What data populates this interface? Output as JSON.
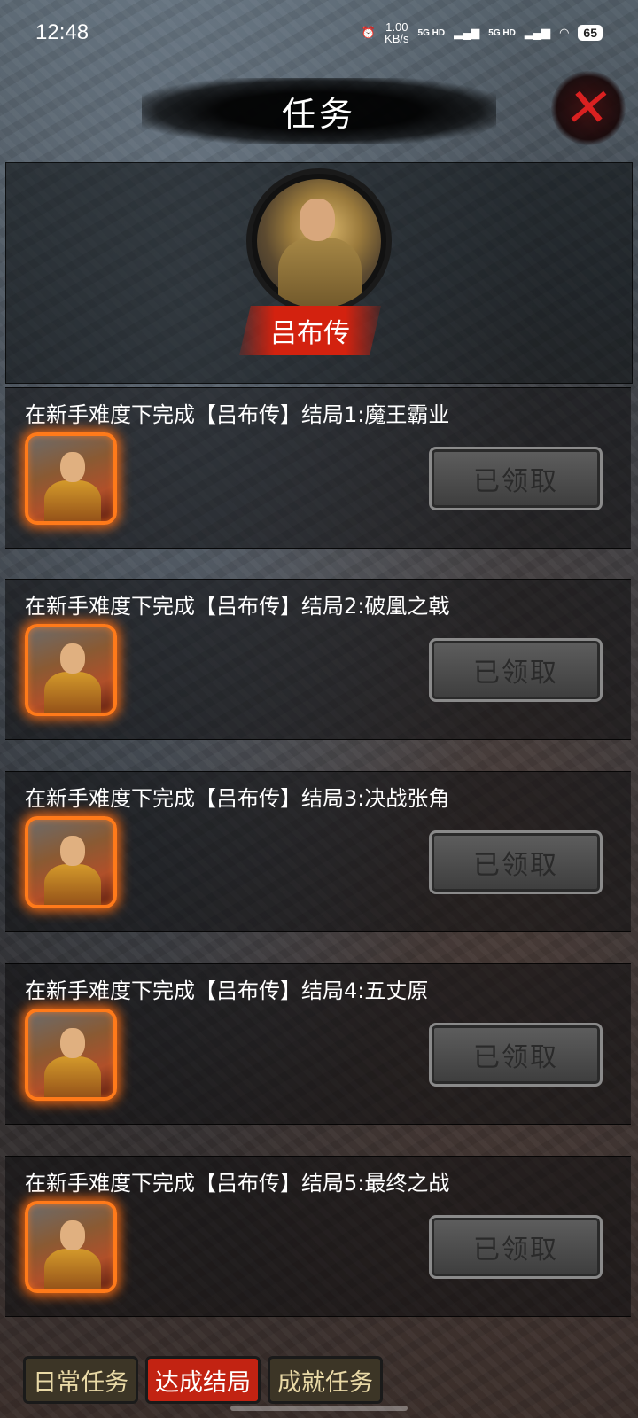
{
  "status_bar": {
    "time": "12:48",
    "rate_value": "1.00",
    "rate_unit": "KB/s",
    "net1": "5G HD",
    "net2": "5G HD",
    "battery": "65"
  },
  "header": {
    "title": "任务",
    "hero_name": "吕布传"
  },
  "tasks": [
    {
      "title": "在新手难度下完成【吕布传】结局1:魔王霸业",
      "button": "已领取"
    },
    {
      "title": "在新手难度下完成【吕布传】结局2:破凰之戟",
      "button": "已领取"
    },
    {
      "title": "在新手难度下完成【吕布传】结局3:决战张角",
      "button": "已领取"
    },
    {
      "title": "在新手难度下完成【吕布传】结局4:五丈原",
      "button": "已领取"
    },
    {
      "title": "在新手难度下完成【吕布传】结局5:最终之战",
      "button": "已领取"
    }
  ],
  "tabs": [
    {
      "label": "日常任务",
      "active": false
    },
    {
      "label": "达成结局",
      "active": true
    },
    {
      "label": "成就任务",
      "active": false
    }
  ],
  "colors": {
    "accent_red": "#c22312",
    "glow_orange": "#ff7a1a",
    "tab_inactive": "#3c3526"
  }
}
